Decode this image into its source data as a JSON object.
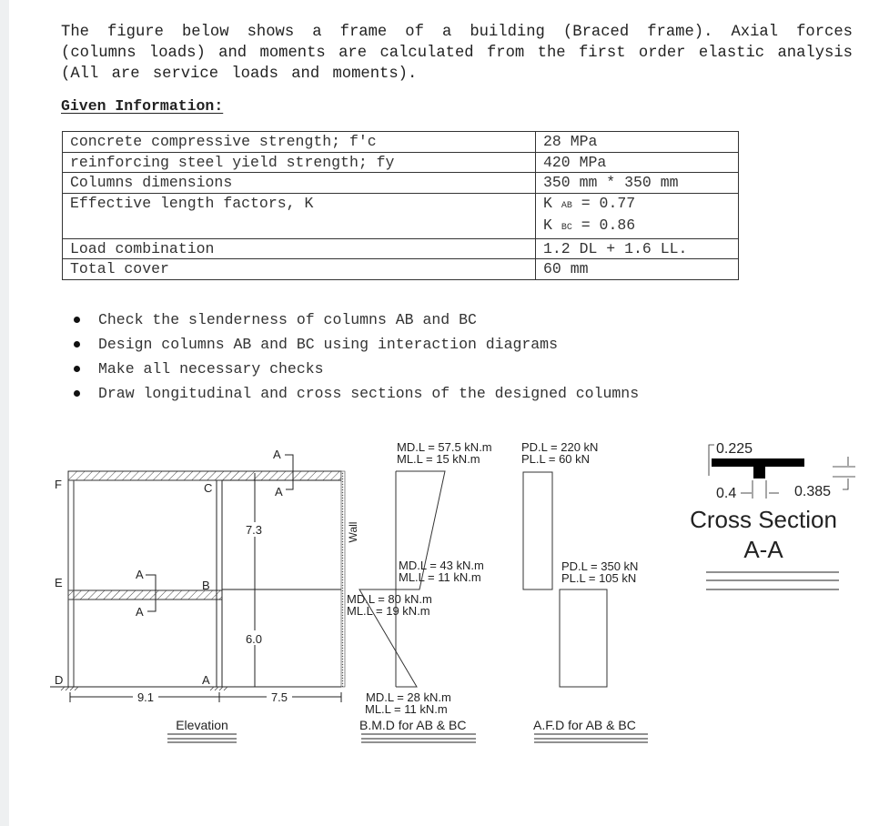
{
  "intro": {
    "text": "The figure below shows a frame of a building (Braced frame). Axial forces (columns loads) and moments are calculated from the first order elastic analysis (All are service loads and moments)."
  },
  "given_heading": "Given Information:",
  "given_table": {
    "rows": [
      {
        "label": "concrete compressive strength; f′c",
        "value": "28 MPa"
      },
      {
        "label": "reinforcing steel yield strength; fy",
        "value": "420 MPa"
      },
      {
        "label": "Columns dimensions",
        "value": "350 mm * 350 mm"
      },
      {
        "label": "Effective length factors, K",
        "value_lines": [
          {
            "k": "K",
            "sub": "AB",
            "eq": "= 0.77"
          },
          {
            "k": "K",
            "sub": "BC",
            "eq": "= 0.86"
          }
        ]
      },
      {
        "label": "Load combination",
        "value": "1.2 DL + 1.6 LL."
      },
      {
        "label": "Total cover",
        "value": "60 mm"
      }
    ]
  },
  "tasks": [
    "Check the slenderness of columns AB and BC",
    "Design columns AB and BC using interaction diagrams",
    "Make all necessary checks",
    "Draw longitudinal and cross sections of the designed columns"
  ],
  "elevation": {
    "title": "Elevation",
    "joint_labels": {
      "F": "F",
      "E": "E",
      "D": "D",
      "C": "C",
      "B": "B",
      "A": "A"
    },
    "section_marks": [
      "A",
      "A",
      "A",
      "A"
    ],
    "wall_label": "Wall",
    "heights": {
      "upper": "7.3",
      "lower": "6.0"
    },
    "spans": {
      "left": "9.1",
      "right": "7.5"
    }
  },
  "bmd": {
    "title": "B.M.D for AB & BC",
    "top": {
      "md": "MD.L = 57.5 kN.m",
      "ml": "ML.L = 15 kN.m"
    },
    "mid_upper": {
      "md": "MD.L = 43 kN.m",
      "ml": "ML.L = 11 kN.m"
    },
    "mid_lower": {
      "md": "MD.L = 80 kN.m",
      "ml": "ML.L = 19 kN.m"
    },
    "bottom": {
      "md": "MD.L = 28 kN.m",
      "ml": "ML.L = 11 kN.m"
    }
  },
  "afd": {
    "title": "A.F.D for AB & BC",
    "upper": {
      "pd": "PD.L = 220 kN",
      "pl": "PL.L = 60 kN"
    },
    "lower": {
      "pd": "PD.L = 350 kN",
      "pl": "PL.L = 105 kN"
    }
  },
  "cross_section": {
    "title_line1": "Cross Section",
    "title_line2": "A-A",
    "dims": {
      "flange": "0.225",
      "web": "0.4",
      "depth": "0.385"
    }
  }
}
